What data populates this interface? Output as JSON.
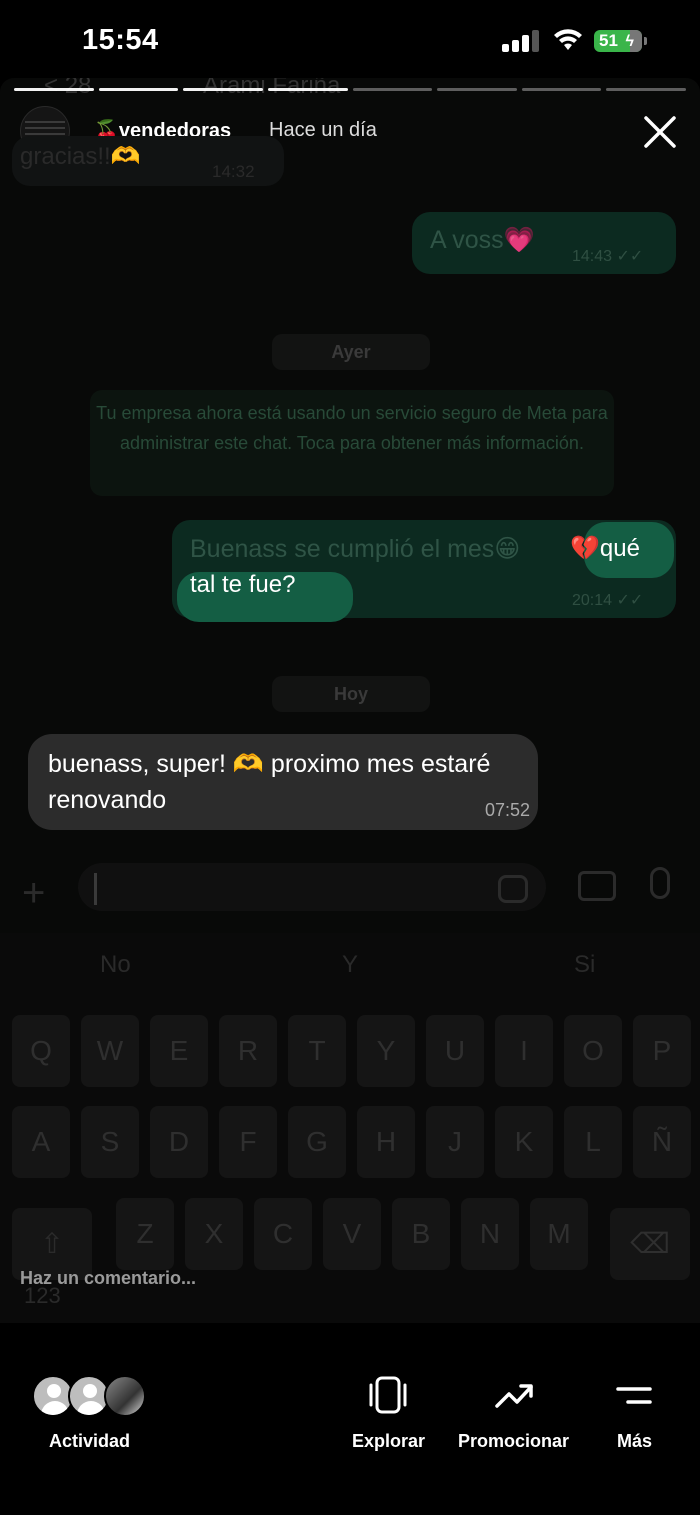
{
  "status_bar": {
    "time": "15:54",
    "battery": "51"
  },
  "story": {
    "username": "🍒vendedoras",
    "posted": "Hace un día",
    "segments_total": 8,
    "segments_seen": 4
  },
  "chat": {
    "ghost_top_name": "Arami Fariña",
    "ghost_top_count": "28",
    "ghost_first_msg": "gracias!!🫶",
    "ghost_first_time": "14:32",
    "out_msg_1": "A voss💗",
    "out_msg_1_time": "14:43",
    "date_yesterday": "Ayer",
    "notice": "Tu empresa ahora está usando un servicio seguro de Meta para administrar este chat. Toca para obtener más información.",
    "out_msg_2_part1": "Buenass se cumplió el mes😁",
    "out_msg_2_hl1": "💔qué",
    "out_msg_2_hl2": "tal te fue?",
    "out_msg_2_time": "20:14",
    "date_today": "Hoy",
    "reply_text": "buenass, super! 🫶 proximo mes estaré renovando",
    "reply_time": "07:52"
  },
  "keyboard": {
    "suggestions": [
      "No",
      "Y",
      "Si"
    ],
    "row1": [
      "Q",
      "W",
      "E",
      "R",
      "T",
      "Y",
      "U",
      "I",
      "O",
      "P"
    ],
    "row2": [
      "A",
      "S",
      "D",
      "F",
      "G",
      "H",
      "J",
      "K",
      "L",
      "Ñ"
    ],
    "row3": [
      "Z",
      "X",
      "C",
      "V",
      "B",
      "N",
      "M"
    ],
    "numkey": "123"
  },
  "comment": {
    "placeholder": "Haz un comentario..."
  },
  "bottom_nav": {
    "activity": "Actividad",
    "explore": "Explorar",
    "promote": "Promocionar",
    "more": "Más"
  }
}
